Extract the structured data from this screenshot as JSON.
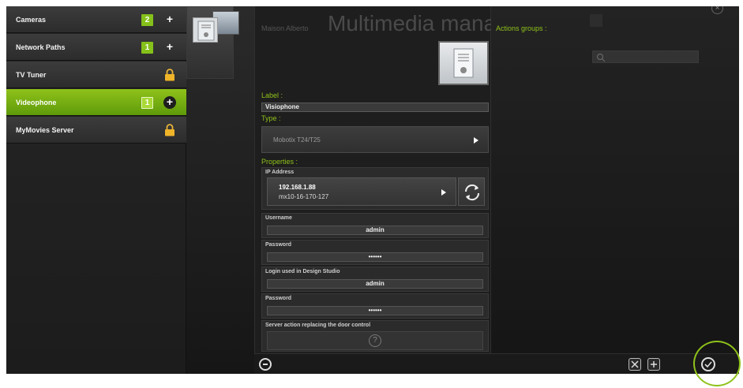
{
  "sidebar": {
    "items": [
      {
        "label": "Cameras",
        "count": "2",
        "action": "+"
      },
      {
        "label": "Network Paths",
        "count": "1",
        "action": "+"
      },
      {
        "label": "TV Tuner"
      },
      {
        "label": "Videophone",
        "count": "1",
        "action": "+"
      },
      {
        "label": "MyMovies Server"
      }
    ]
  },
  "panel": {
    "owner": "Maison Alberto",
    "title": "Multimedia management",
    "label_caption": "Label :",
    "label_value": "Visiophone",
    "type_caption": "Type :",
    "type_value": "Mobotix T24/T25",
    "properties_caption": "Properties :",
    "ip_caption": "IP Address",
    "ip_value": "192.168.1.88",
    "ip_host": "mx10-16-170-127",
    "username_caption": "Username",
    "username_value": "admin",
    "password_caption": "Password",
    "password_value": "••••••",
    "login_ds_caption": "Login used in Design Studio",
    "login_ds_value": "admin",
    "password2_caption": "Password",
    "password2_value": "••••••",
    "server_action_caption": "Server action replacing the door control",
    "help_glyph": "?"
  },
  "right": {
    "actions_groups": "Actions groups :"
  },
  "colors": {
    "accent": "#8fc21a",
    "background": "#1a1a1a"
  },
  "icons": [
    "plus-icon",
    "lock-icon",
    "refresh-icon",
    "play-arrow-icon",
    "minus-icon",
    "x-icon",
    "plus-square-icon",
    "check-icon",
    "search-icon",
    "close-icon",
    "help-icon"
  ]
}
